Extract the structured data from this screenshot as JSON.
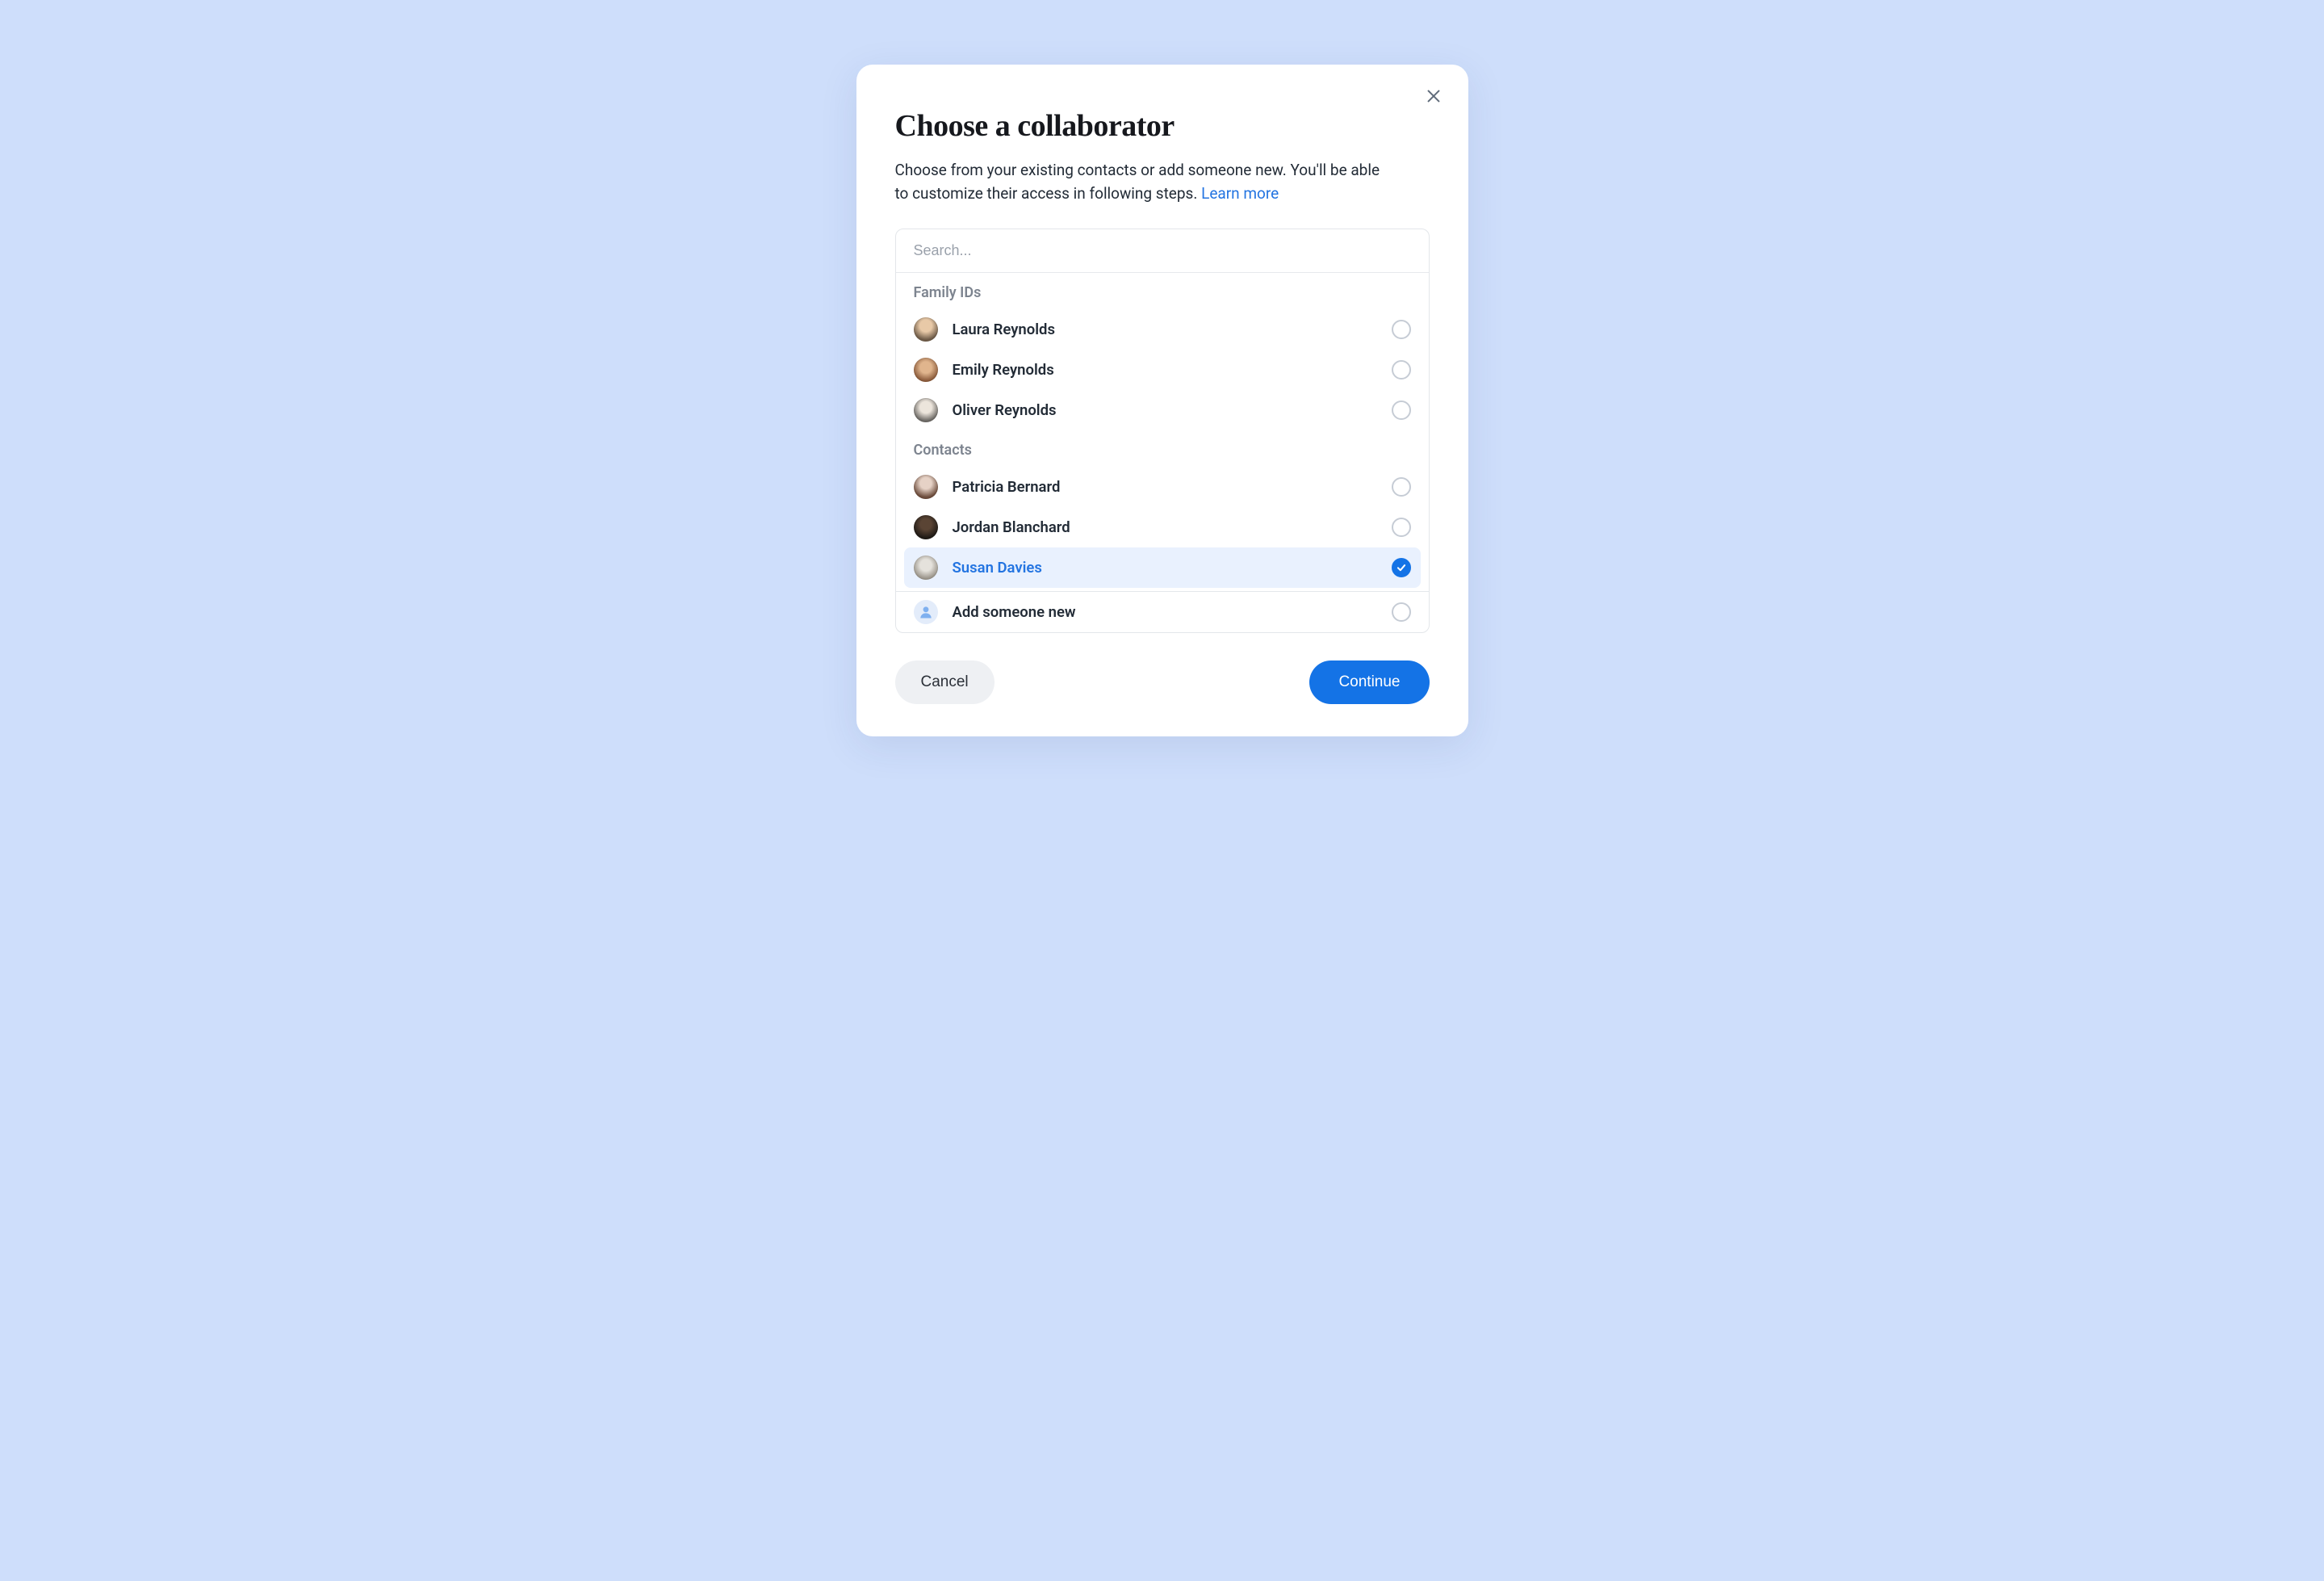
{
  "modal": {
    "title": "Choose a collaborator",
    "subtitle": "Choose from your existing contacts or add someone new. You'll be able to customize their access in following steps. ",
    "learn_more_label": "Learn more",
    "search_placeholder": "Search...",
    "add_new_label": "Add someone new",
    "cancel_label": "Cancel",
    "continue_label": "Continue"
  },
  "sections": {
    "family_header": "Family IDs",
    "contacts_header": "Contacts"
  },
  "family": [
    {
      "name": "Laura Reynolds",
      "selected": false,
      "avatar_bg": "radial-gradient(circle at 50% 35%, #e8c9a7 30%, #6d5a47 70%)"
    },
    {
      "name": "Emily Reynolds",
      "selected": false,
      "avatar_bg": "radial-gradient(circle at 50% 40%, #e0b58d 30%, #8a5a3a 70%)"
    },
    {
      "name": "Oliver Reynolds",
      "selected": false,
      "avatar_bg": "radial-gradient(circle at 50% 38%, #ece5dc 30%, #6b6864 70%)"
    }
  ],
  "contacts": [
    {
      "name": "Patricia Bernard",
      "selected": false,
      "avatar_bg": "radial-gradient(circle at 50% 35%, #e6d2c6 28%, #6b4b3b 70%)"
    },
    {
      "name": "Jordan Blanchard",
      "selected": false,
      "avatar_bg": "radial-gradient(circle at 50% 38%, #5a4434 28%, #1f1a15 70%)"
    },
    {
      "name": "Susan Davies",
      "selected": true,
      "avatar_bg": "radial-gradient(circle at 50% 40%, #e5e2dc 30%, #9a948a 70%)"
    }
  ]
}
